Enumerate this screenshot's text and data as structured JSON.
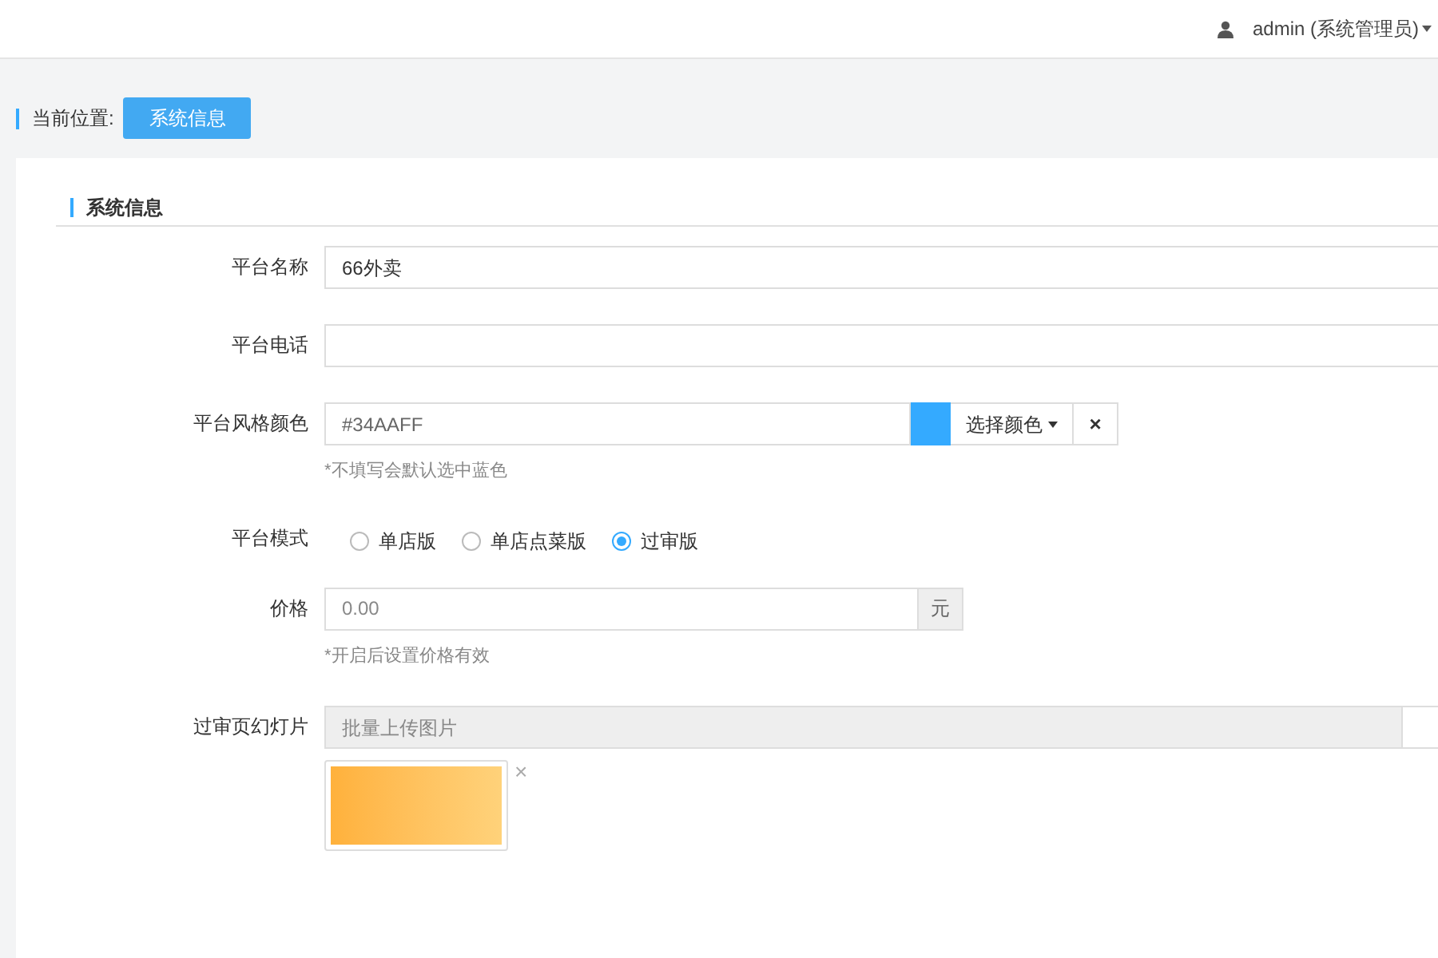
{
  "header": {
    "user": "admin (系统管理员)"
  },
  "breadcrumb": {
    "label": "当前位置:",
    "current": "系统信息"
  },
  "section": {
    "title": "系统信息"
  },
  "form": {
    "name": {
      "label": "平台名称",
      "value": "66外卖"
    },
    "phone": {
      "label": "平台电话"
    },
    "color": {
      "label": "平台风格颜色",
      "value": "#34AAFF",
      "pick_button": "选择颜色",
      "clear_button": "×",
      "hint": "*不填写会默认选中蓝色"
    },
    "mode": {
      "label": "平台模式",
      "options": [
        {
          "label": "单店版",
          "selected": false
        },
        {
          "label": "单店点菜版",
          "selected": false
        },
        {
          "label": "过审版",
          "selected": true
        }
      ]
    },
    "price": {
      "label": "价格",
      "placeholder": "0.00",
      "unit": "元",
      "hint": "*开启后设置价格有效"
    },
    "slides": {
      "label": "过审页幻灯片",
      "placeholder": "批量上传图片",
      "remove": "×"
    }
  }
}
